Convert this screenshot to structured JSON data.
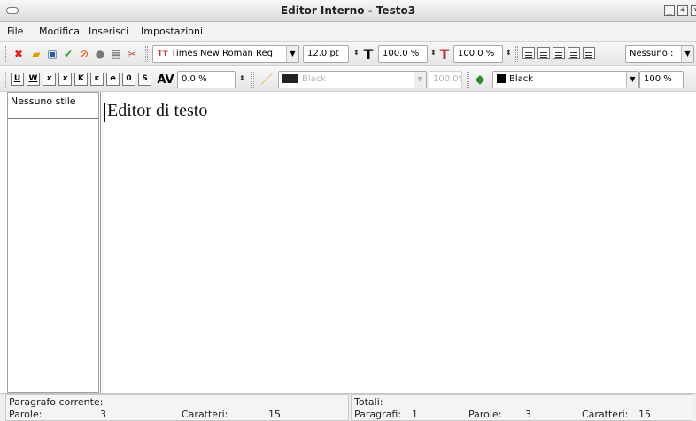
{
  "window": {
    "title": "Editor Interno - Testo3",
    "controls": [
      "minimize-icon",
      "maximize-icon",
      "close-icon"
    ]
  },
  "menu": {
    "items": [
      "File",
      "Modifica",
      "Inserisci",
      "Impostazioni"
    ]
  },
  "toolbar1": {
    "font_family": "Times New Roman Reg",
    "font_size": "12.0 pt",
    "scale_width": "100.0 %",
    "scale_height": "100.0 %",
    "style_combo": "Nessuno :"
  },
  "toolbar2": {
    "tracking": "0.0 %",
    "stroke_color": "Black",
    "stroke_shade": "100.0%",
    "fill_color": "Black",
    "fill_shade": "100 %",
    "style_buttons": [
      "U",
      "W",
      "x",
      "x",
      "K",
      "K",
      "e",
      "0",
      "S"
    ]
  },
  "styles_panel": {
    "header": "Nessuno stile"
  },
  "editor": {
    "content": "Editor di testo"
  },
  "status": {
    "current_paragraph_label": "Paragrafo corrente:",
    "words_label": "Parole:",
    "words_value": "3",
    "chars_label": "Caratteri:",
    "chars_value": "15",
    "totals_label": "Totali:",
    "paragraphs_label": "Paragrafi:",
    "paragraphs_value": "1",
    "total_words_label": "Parole:",
    "total_words_value": "3",
    "total_chars_label": "Caratteri:",
    "total_chars_value": "15"
  },
  "colors": {
    "accent": "#d0d0d0",
    "editor_bg": "#ffffff"
  }
}
